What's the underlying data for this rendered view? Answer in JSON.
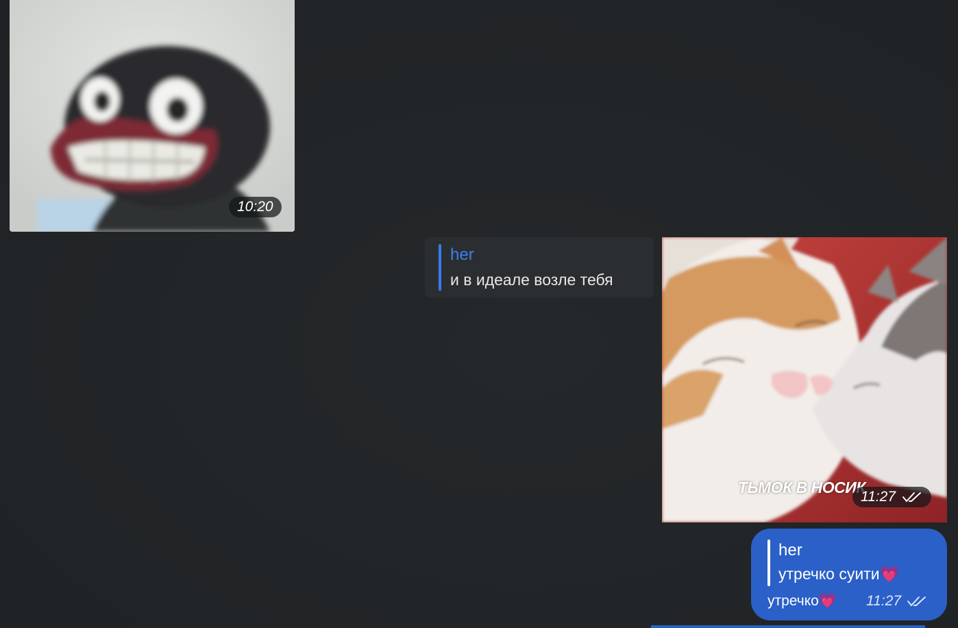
{
  "colors": {
    "background": "#222527",
    "accent_blue": "#3b7ff0",
    "outgoing_bubble": "#2a60c7",
    "reply_box": "#2b2e31"
  },
  "messages": [
    {
      "type": "photo",
      "direction": "incoming",
      "image": "plush penguin (Pingu) grinning",
      "time": "10:20"
    },
    {
      "type": "photo",
      "direction": "outgoing",
      "image": "two cats touching noses",
      "caption": "ТЬМОК В НОСИК",
      "time": "11:27",
      "status_icon": "double-check-icon",
      "reply": {
        "author": "her",
        "text": "и в идеале возле тебя"
      }
    },
    {
      "type": "text",
      "direction": "outgoing",
      "reply": {
        "author": "her",
        "text": "утречко суити💗"
      },
      "text": "утречко💗",
      "time": "11:27",
      "status_icon": "double-check-icon"
    }
  ]
}
